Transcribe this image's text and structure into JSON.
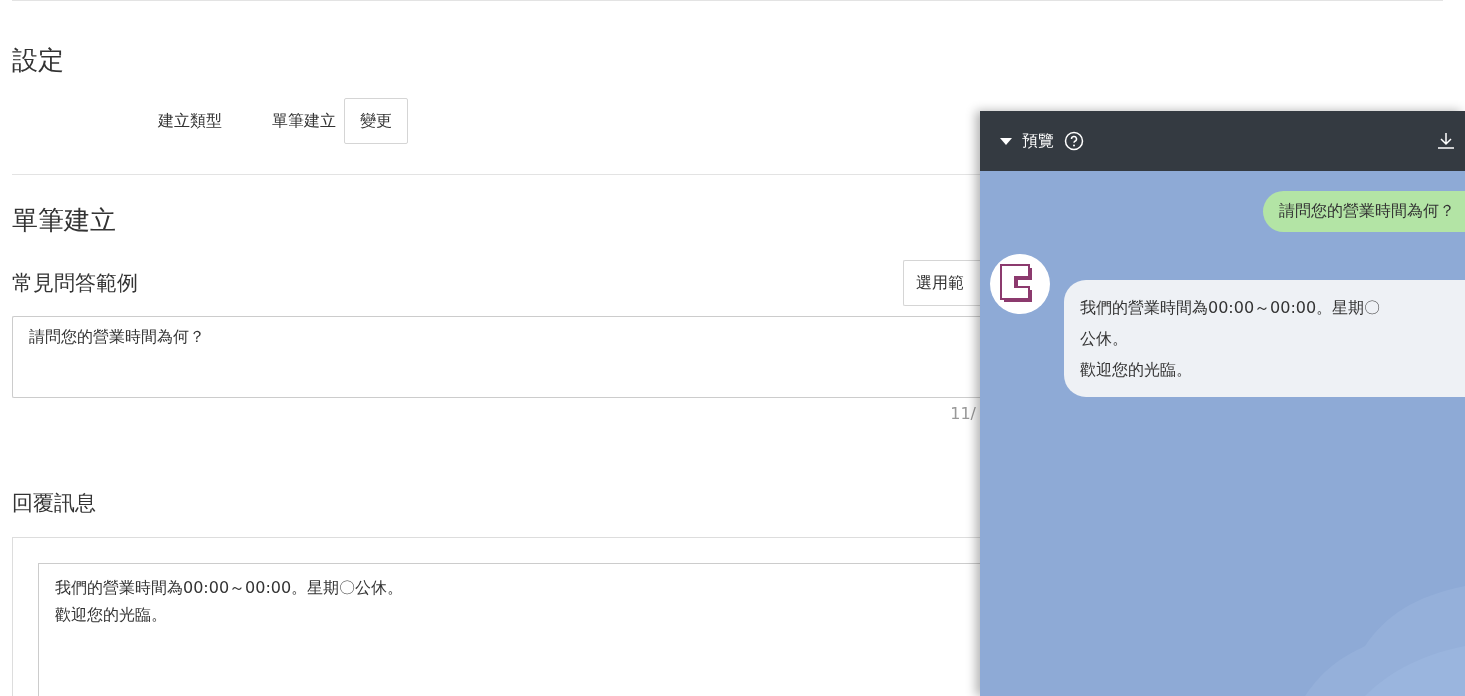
{
  "settings": {
    "heading": "設定",
    "create_type": {
      "label": "建立類型",
      "value": "單筆建立",
      "button": "變更"
    }
  },
  "single": {
    "heading": "單筆建立",
    "faq": {
      "label": "常見問答範例",
      "template_button": "選用範",
      "value": "請問您的營業時間為何？",
      "counter": "11/"
    },
    "reply": {
      "label": "回覆訊息",
      "lines": [
        "我們的營業時間為00:00～00:00。星期〇公休。",
        "歡迎您的光臨。"
      ]
    }
  },
  "preview": {
    "title": "預覽",
    "expanded": true,
    "messages": [
      {
        "kind": "user",
        "text": "請問您的營業時間為何？"
      },
      {
        "kind": "bot",
        "lines": [
          "我們的營業時間為00:00～00:00。星期〇",
          "公休。",
          "歡迎您的光臨。"
        ]
      }
    ]
  }
}
